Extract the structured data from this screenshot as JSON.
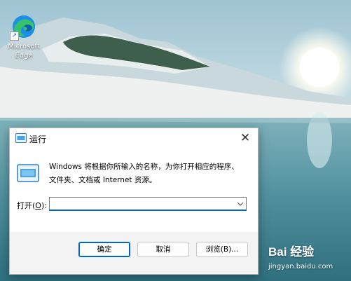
{
  "desktop": {
    "edge_label_line1": "Microsoft",
    "edge_label_line2": "Edge",
    "icon": "edge-icon"
  },
  "dialog": {
    "title": "运行",
    "close_glyph": "✕",
    "description_line1": "Windows 将根据你所输入的名称，为你打开相应的程序、",
    "description_line2": "文件夹、文档或 Internet 资源。",
    "open_label_prefix": "打开(",
    "open_label_key": "O",
    "open_label_suffix": "):",
    "input_value": "",
    "buttons": {
      "ok": "确定",
      "cancel": "取消",
      "browse": "浏览(B)..."
    }
  },
  "watermark": {
    "logo_text": "Bai 经验",
    "url": "jingyan.baidu.com"
  },
  "colors": {
    "accent": "#0067c0",
    "dialog_bg": "#f3f3f3"
  }
}
